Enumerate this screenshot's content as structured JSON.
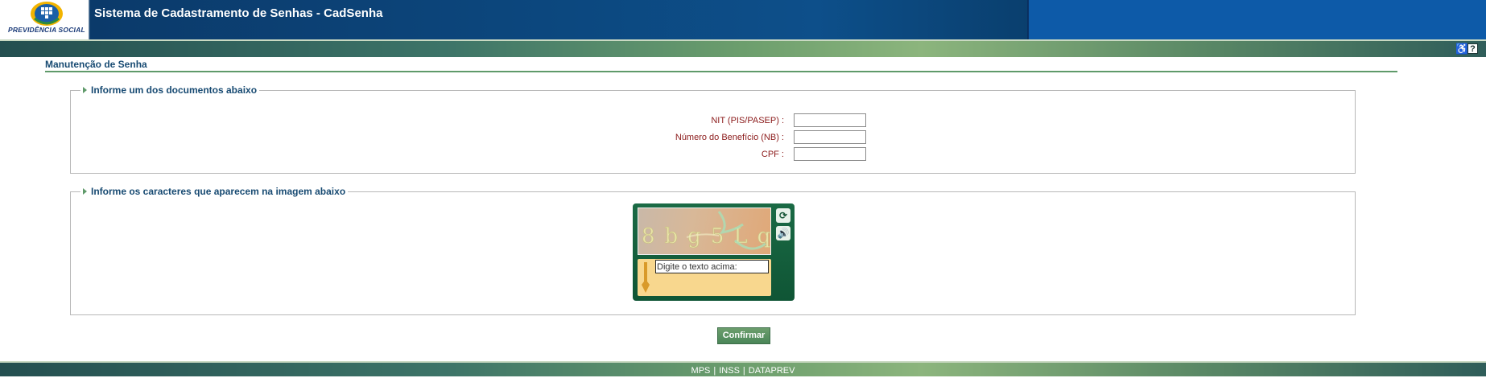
{
  "header": {
    "logo_text": "PREVIDÊNCIA SOCIAL",
    "title": "Sistema de Cadastramento de Senhas - CadSenha"
  },
  "toolbar": {
    "accessibility_icon": "wheelchair-icon",
    "help_label": "?"
  },
  "page": {
    "title": "Manutenção de Senha"
  },
  "documents": {
    "legend": "Informe um dos documentos abaixo",
    "fields": [
      {
        "label": "NIT (PIS/PASEP) :",
        "value": ""
      },
      {
        "label": "Número do Benefício (NB) :",
        "value": ""
      },
      {
        "label": "CPF :",
        "value": ""
      }
    ]
  },
  "captcha": {
    "legend": "Informe os caracteres que aparecem na imagem abaixo",
    "image_text": "8bg5Lq",
    "refresh_icon": "refresh-icon",
    "audio_icon": "speaker-icon",
    "input_value": "Digite o texto acima:"
  },
  "actions": {
    "confirm_label": "Confirmar"
  },
  "footer": {
    "links": [
      "MPS",
      "INSS",
      "DATAPREV"
    ],
    "separator": "|"
  },
  "colors": {
    "header_blue": "#0d4f8a",
    "band_green": "#6c9e6d",
    "label_red": "#8b1a1a",
    "title_blue": "#174a72"
  }
}
